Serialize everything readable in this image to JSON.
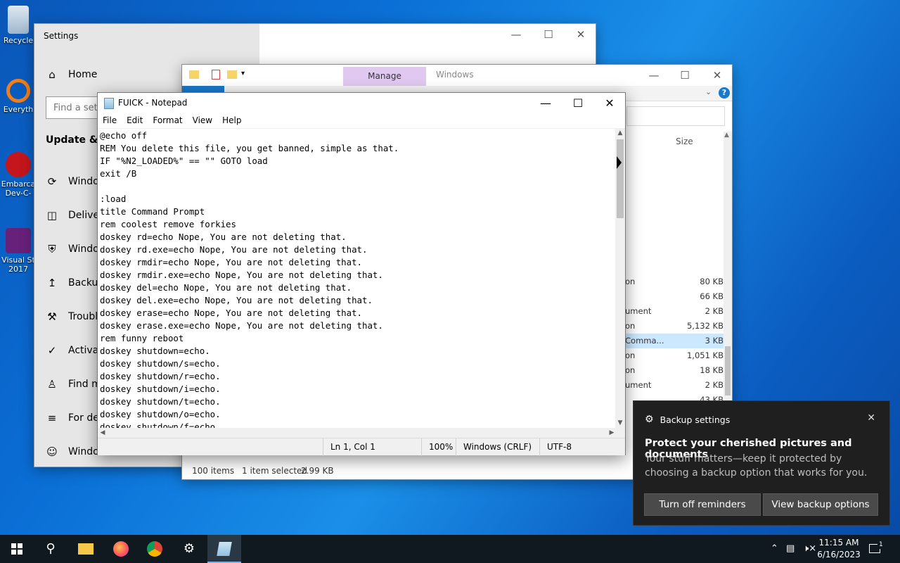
{
  "desktop": {
    "icons": [
      {
        "label": "Recycle",
        "icon": "recycle-bin-icon"
      },
      {
        "label": "Everyth",
        "icon": "everything-search-icon"
      },
      {
        "label1": "Embarca",
        "label2": "Dev-C-",
        "icon": "devcpp-icon"
      },
      {
        "label1": "Visual St",
        "label2": "2017",
        "icon": "visual-studio-icon"
      }
    ]
  },
  "settings": {
    "title": "Settings",
    "home": "Home",
    "find_placeholder": "Find a sett",
    "section": "Update & Se",
    "items": [
      {
        "label": "Windo",
        "icon": "refresh-icon"
      },
      {
        "label": "Deliver",
        "icon": "delivery-icon"
      },
      {
        "label": "Windo",
        "icon": "shield-icon"
      },
      {
        "label": "Backup",
        "icon": "backup-icon"
      },
      {
        "label": "Trouble",
        "icon": "wrench-icon"
      },
      {
        "label": "Activat",
        "icon": "check-circle-icon"
      },
      {
        "label": "Find m",
        "icon": "person-icon"
      },
      {
        "label": "For dev",
        "icon": "developer-icon"
      },
      {
        "label": "Windo",
        "icon": "insider-icon"
      }
    ]
  },
  "explorer": {
    "manage_tab": "Manage",
    "title": "Windows",
    "size_header": "Size",
    "rows": [
      {
        "type": "on",
        "size": "80 KB",
        "selected": false
      },
      {
        "type": "",
        "size": "66 KB",
        "selected": false
      },
      {
        "type": "ument",
        "size": "2 KB",
        "selected": false
      },
      {
        "type": "on",
        "size": "5,132 KB",
        "selected": false
      },
      {
        "type": "Comma...",
        "size": "3 KB",
        "selected": true
      },
      {
        "type": "on",
        "size": "1,051 KB",
        "selected": false
      },
      {
        "type": "on",
        "size": "18 KB",
        "selected": false
      },
      {
        "type": "ument",
        "size": "2 KB",
        "selected": false
      },
      {
        "type": "",
        "size": "43 KB",
        "selected": false
      }
    ],
    "status_count": "100 items",
    "status_selected": "1 item selected",
    "status_size": "2.99 KB"
  },
  "notepad": {
    "title": "FUICK - Notepad",
    "menu": [
      "File",
      "Edit",
      "Format",
      "View",
      "Help"
    ],
    "content": "@echo off\nREM You delete this file, you get banned, simple as that.\nIF \"%N2_LOADED%\" == \"\" GOTO load\nexit /B\n\n:load\ntitle Command Prompt\nrem coolest remove forkies\ndoskey rd=echo Nope, You are not deleting that.\ndoskey rd.exe=echo Nope, You are not deleting that.\ndoskey rmdir=echo Nope, You are not deleting that.\ndoskey rmdir.exe=echo Nope, You are not deleting that.\ndoskey del=echo Nope, You are not deleting that.\ndoskey del.exe=echo Nope, You are not deleting that.\ndoskey erase=echo Nope, You are not deleting that.\ndoskey erase.exe=echo Nope, You are not deleting that.\nrem funny reboot\ndoskey shutdown=echo.\ndoskey shutdown/s=echo.\ndoskey shutdown/r=echo.\ndoskey shutdown/i=echo.\ndoskey shutdown/t=echo.\ndoskey shutdown/o=echo.\ndoskey shutdown/f=echo.",
    "status": {
      "position": "Ln 1, Col 1",
      "zoom": "100%",
      "line_ending": "Windows (CRLF)",
      "encoding": "UTF-8"
    }
  },
  "toast": {
    "app": "Backup settings",
    "heading": "Protect your cherished pictures and documents",
    "body": "Your stuff matters—keep it protected by choosing a backup option that works for you.",
    "button1": "Turn off reminders",
    "button2": "View backup options"
  },
  "taskbar": {
    "time": "11:15 AM",
    "date": "6/16/2023",
    "notification_count": "1"
  },
  "colors": {
    "desktop_blue": "#0a6fd6",
    "toast_bg": "#1f1f1f",
    "selection": "#cce8ff",
    "manage_tab": "#e0c8f0"
  }
}
